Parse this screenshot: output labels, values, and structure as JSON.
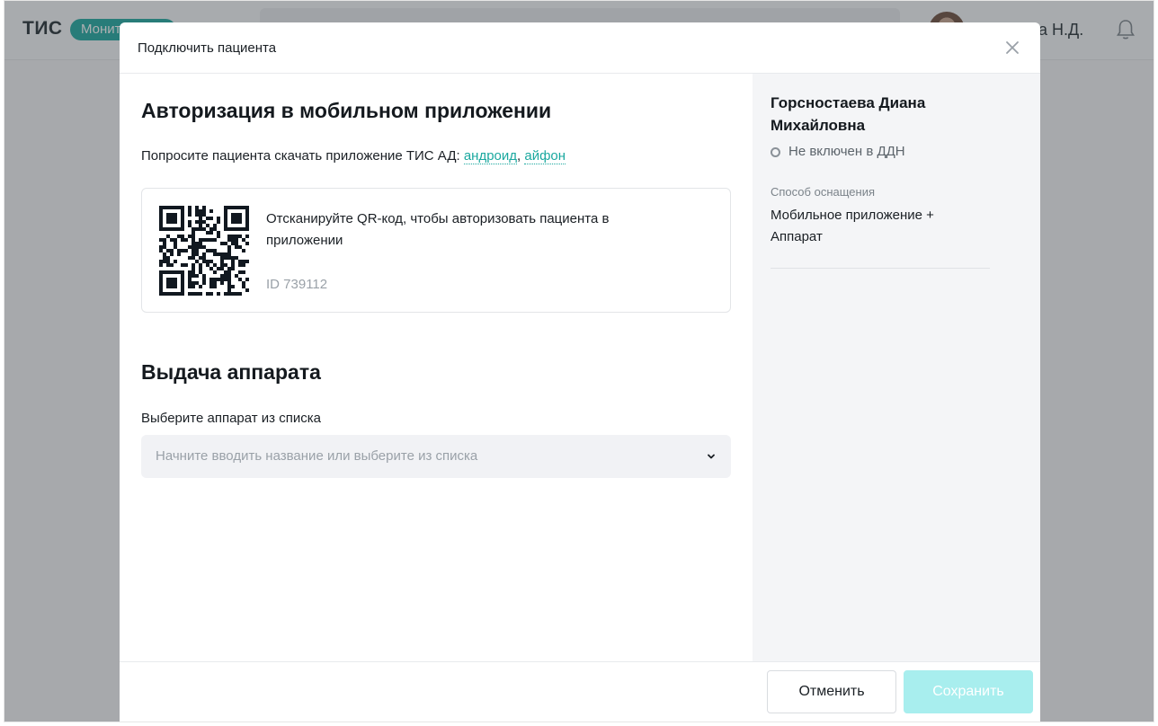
{
  "app": {
    "logo": "ТИС",
    "badge": "Мониторинг",
    "user_name": "а Н.Д."
  },
  "modal": {
    "title": "Подключить пациента",
    "auth": {
      "heading": "Авторизация в мобильном приложении",
      "prompt": "Попросите пациента скачать приложение ТИС АД:",
      "link_android": "андроид",
      "separator": ",",
      "link_iphone": "айфон",
      "qr_instruction": "Отсканируйте QR-код, чтобы авторизовать пациента в приложении",
      "qr_id": "ID 739112"
    },
    "device": {
      "heading": "Выдача аппарата",
      "label": "Выберите аппарат из списка",
      "placeholder": "Начните вводить название или выберите из списка"
    },
    "patient": {
      "name": "Горсностаева Диана Михайловна",
      "status": "Не включен в ДДН",
      "equipment_label": "Способ оснащения",
      "equipment_value": "Мобильное приложение + Аппарат"
    },
    "footer": {
      "cancel_label": "Отменить",
      "save_label": "Сохранить"
    }
  },
  "colors": {
    "accent": "#1aa89f",
    "save_disabled": "#a8eeee",
    "sidebar_bg": "#f4f5f7"
  },
  "icons": [
    "close-icon",
    "chevron-down-icon",
    "bell-icon",
    "qr-code"
  ]
}
